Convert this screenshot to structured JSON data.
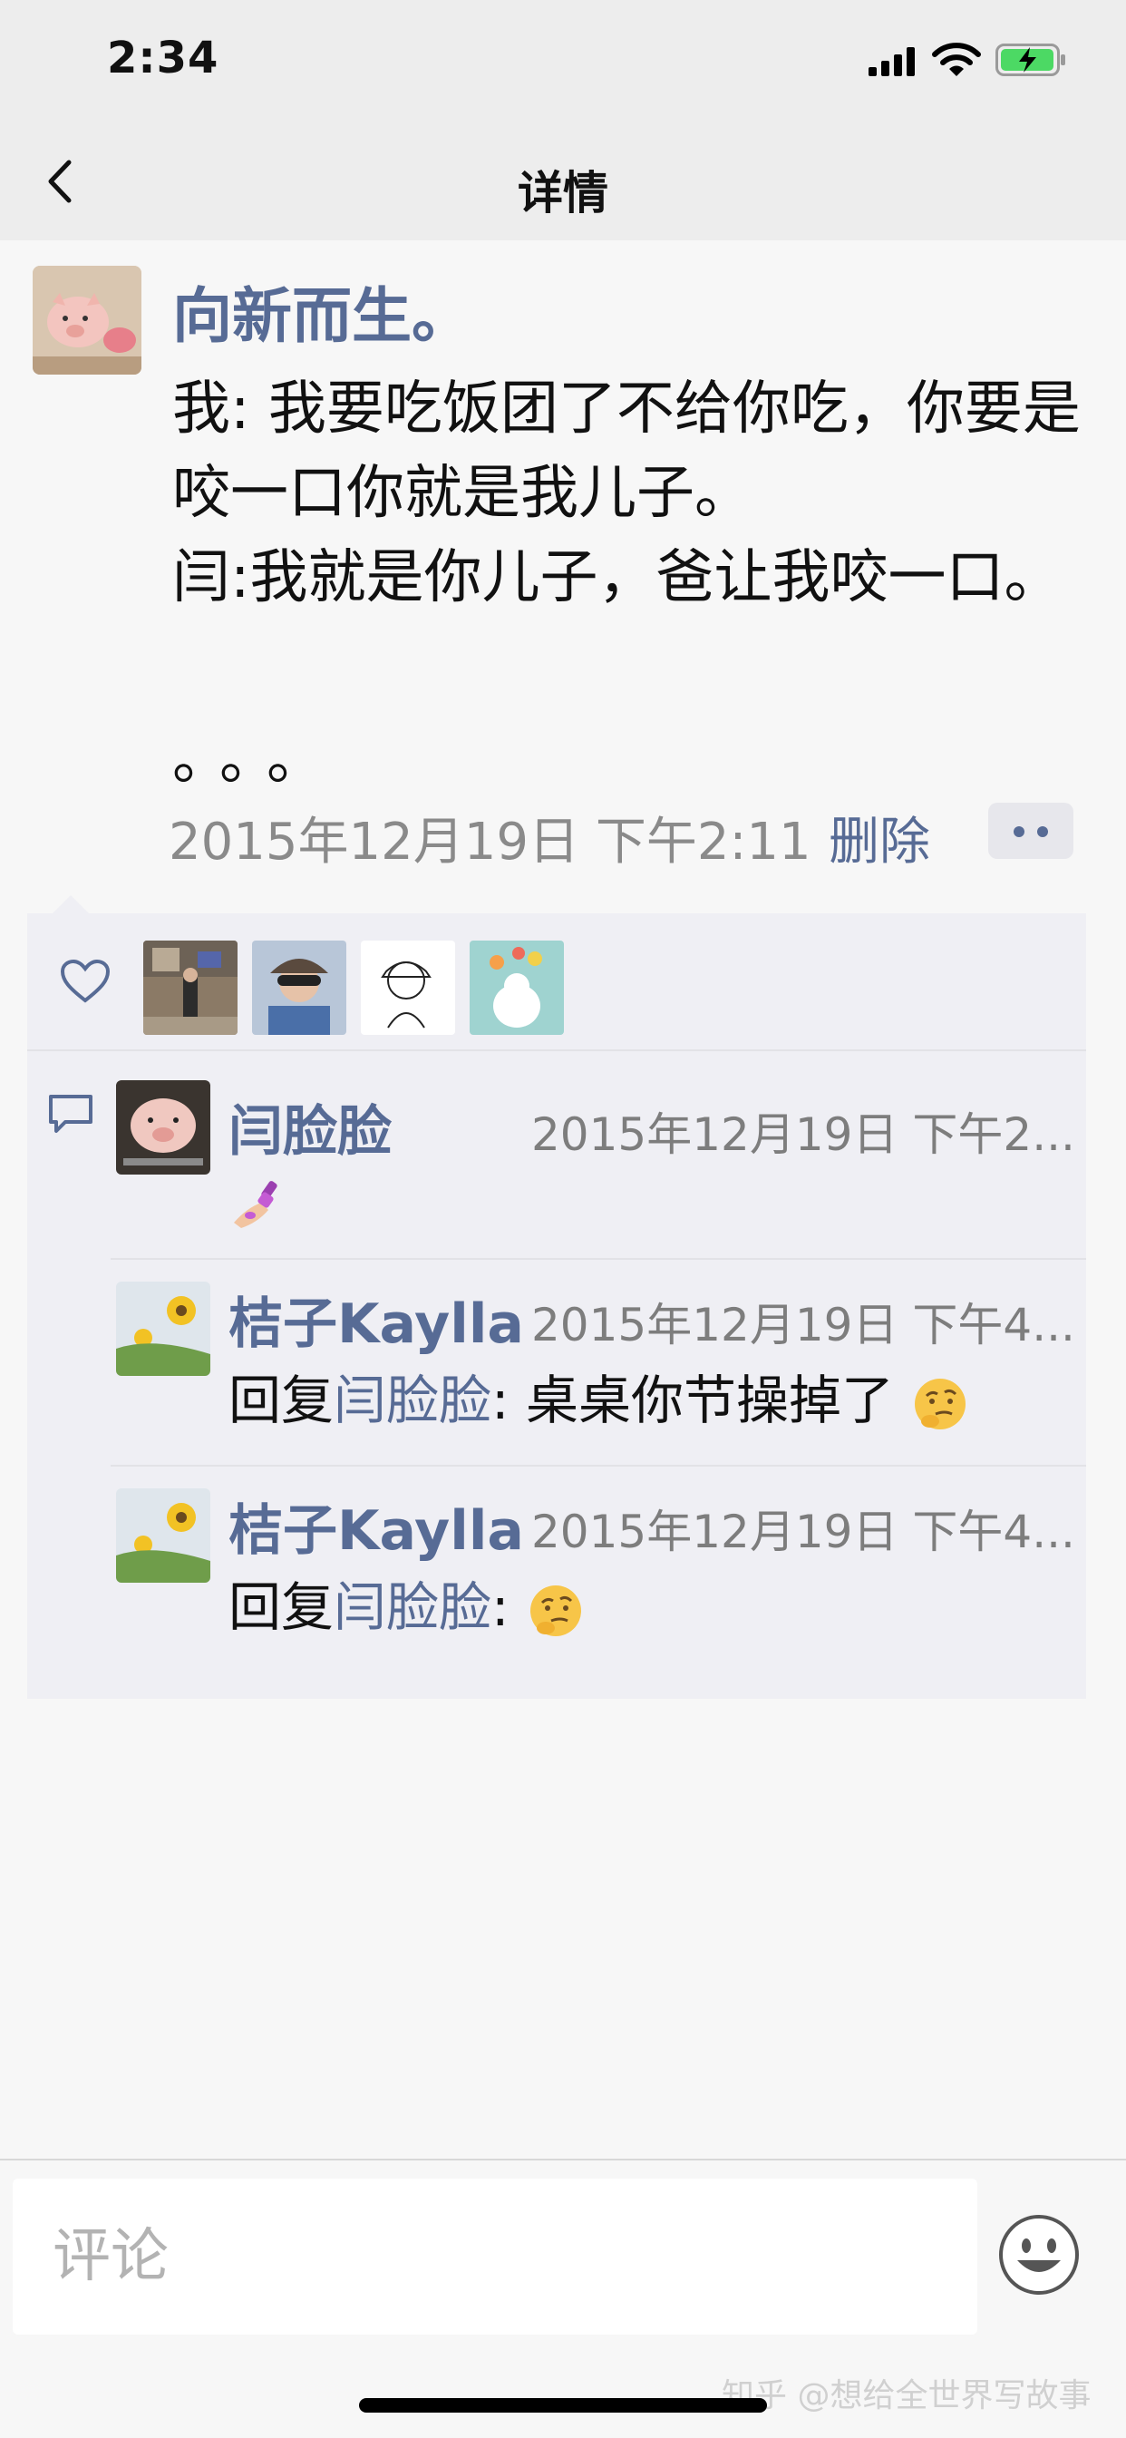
{
  "status_bar": {
    "time": "2:34"
  },
  "nav": {
    "title": "详情"
  },
  "post": {
    "author": "向新而生。",
    "lines": [
      "我: 我要吃饭团了不给你吃，你要是咬一口你就是我儿子。",
      "闫:我就是你儿子，爸让我咬一口。"
    ],
    "dots": "。。。",
    "time": "2015年12月19日 下午2:11",
    "delete_label": "删除"
  },
  "likes": {
    "icon": "heart-icon",
    "count": 4
  },
  "comments": [
    {
      "name": "闫脸脸",
      "time": "2015年12月19日 下午2...",
      "body_emoji": "nail-polish-emoji"
    },
    {
      "name": "桔子Kaylla",
      "time": "2015年12月19日 下午4...",
      "reply_prefix": "回复",
      "reply_to": "闫脸脸",
      "text": ": 桌桌你节操掉了",
      "emoji": "thinking-face-emoji"
    },
    {
      "name": "桔子Kaylla",
      "time": "2015年12月19日 下午4...",
      "reply_prefix": "回复",
      "reply_to": "闫脸脸",
      "text": ": ",
      "emoji": "thinking-face-emoji"
    }
  ],
  "input": {
    "placeholder": "评论"
  },
  "watermark": "知乎 @想给全世界写故事",
  "colors": {
    "link": "#576b95",
    "background": "#f7f7f7",
    "panel": "#efeff4",
    "bar": "#ededed"
  }
}
